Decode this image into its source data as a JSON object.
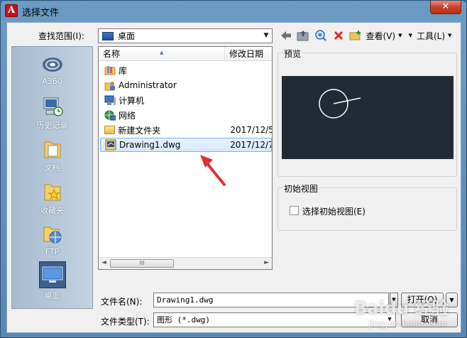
{
  "window": {
    "title": "选择文件",
    "close_label": "✕",
    "app_icon_letter": "A"
  },
  "toolbar": {
    "lookin_label": "查找范围(I):",
    "lookin_value": "桌面",
    "views_label": "查看(V)",
    "tools_label": "工具(L)"
  },
  "places": [
    {
      "label": "A360",
      "icon": "a360-cloud-icon"
    },
    {
      "label": "历史记录",
      "icon": "history-computer-icon"
    },
    {
      "label": "文档",
      "icon": "documents-folder-icon"
    },
    {
      "label": "收藏夹",
      "icon": "favorites-folder-icon"
    },
    {
      "label": "FTP",
      "icon": "ftp-icon"
    },
    {
      "label": "桌面",
      "icon": "desktop-icon"
    }
  ],
  "file_list": {
    "columns": [
      "名称",
      "修改日期"
    ],
    "rows": [
      {
        "name": "库",
        "date": "",
        "icon": "library-icon"
      },
      {
        "name": "Administrator",
        "date": "",
        "icon": "user-folder-icon"
      },
      {
        "name": "计算机",
        "date": "",
        "icon": "computer-icon"
      },
      {
        "name": "网络",
        "date": "",
        "icon": "network-icon"
      },
      {
        "name": "新建文件夹",
        "date": "2017/12/5",
        "icon": "folder-icon"
      },
      {
        "name": "Drawing1.dwg",
        "date": "2017/12/7",
        "icon": "dwg-file-icon",
        "selected": true
      }
    ],
    "scroll_thumb_grip": "III"
  },
  "preview": {
    "title": "预览"
  },
  "initial_view": {
    "title": "初始视图",
    "checkbox_label": "选择初始视图(E)",
    "checked": false
  },
  "bottom": {
    "filename_label": "文件名(N):",
    "filename_value": "Drawing1.dwg",
    "filetype_label": "文件类型(T):",
    "filetype_value": "图形 (*.dwg)",
    "open_label": "打开(O)",
    "cancel_label": "取消"
  },
  "watermark": {
    "line1": "Baidu 经验",
    "line2": "jingyan.baidu.com"
  },
  "colors": {
    "selection": "#d6e8fc",
    "preview_bg": "#222a34",
    "arrow_red": "#e03030",
    "close_red": "#c7422b"
  }
}
